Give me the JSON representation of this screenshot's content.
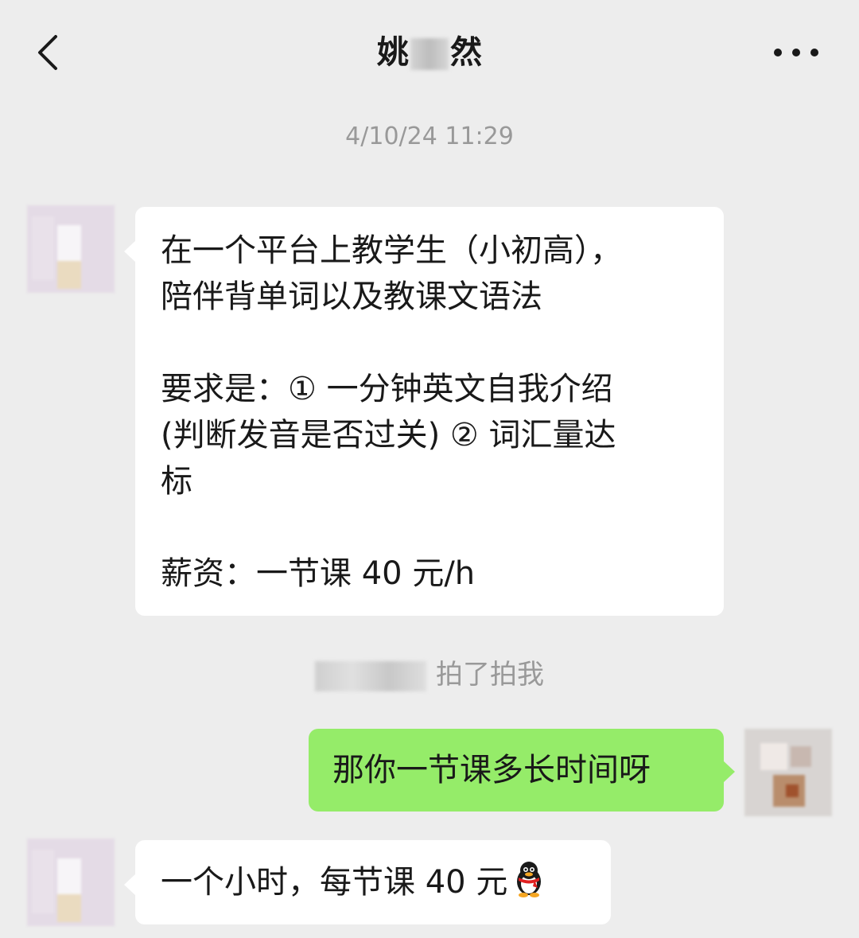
{
  "header": {
    "title_start": "姚",
    "title_end": "然"
  },
  "icons": {
    "back": "chevron-left-icon",
    "more": "more-dots-icon",
    "penguin": "qq-penguin-icon"
  },
  "colors": {
    "background": "#ededed",
    "incoming_bubble": "#ffffff",
    "outgoing_bubble": "#95ec69",
    "timestamp": "#999999"
  },
  "chat": {
    "timestamp": "4/10/24 11:29",
    "messages": [
      {
        "side": "left",
        "text": "在一个平台上教学生（小初高），\n陪伴背单词以及教课文语法\n\n要求是：① 一分钟英文自我介绍\n(判断发音是否过关) ② 词汇量达\n标\n\n薪资：一节课 40 元/h"
      },
      {
        "side": "right",
        "text": "那你一节课多长时间呀"
      },
      {
        "side": "left",
        "text": "一个小时，每节课 40 元"
      }
    ],
    "system_notice": "拍了拍我"
  }
}
